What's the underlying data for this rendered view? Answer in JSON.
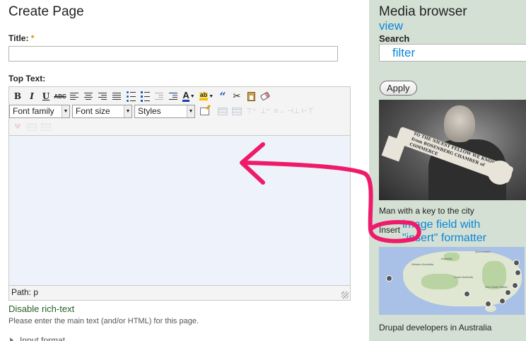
{
  "page": {
    "title": "Create Page",
    "title_field": {
      "label": "Title:",
      "required_mark": "*",
      "value": ""
    },
    "top_text": {
      "label": "Top Text:"
    },
    "editor": {
      "toolbar_row1": [
        "bold-button",
        "italic-button",
        "underline-button",
        "strikethrough-button",
        "align-left-button",
        "align-center-button",
        "align-right-button",
        "align-justify-button",
        "bullet-list-button",
        "numbered-list-button",
        "outdent-button",
        "indent-button",
        "font-color-button",
        "highlight-color-button",
        "blockquote-button",
        "cut-button",
        "paste-button",
        "remove-format-button"
      ],
      "bold": "B",
      "italic": "I",
      "underline": "U",
      "strike": "ABC",
      "font_family": "Font family",
      "font_size": "Font size",
      "styles": "Styles",
      "path": "Path: p"
    },
    "disable_link": "Disable rich-text",
    "help": "Please enter the main text (and/or HTML) for this page.",
    "input_format": "Input format"
  },
  "sidebar": {
    "title": "Media browser",
    "view_link": "view",
    "search_label": "Search",
    "search_value": "filter",
    "apply_label": "Apply",
    "photo_key_text": [
      "TO THE NICEST FELLOW WE KNOW",
      "from ROSENBERG CHAMBER of COMMERCE"
    ],
    "caption1": "Man with a key to the city",
    "insert_label": "Insert",
    "annotation": [
      "image field with",
      "\"insert\" formatter"
    ],
    "map_labels": [
      "Western Australia",
      "Australia",
      "South Australia",
      "Queensland",
      "New South Wales"
    ],
    "caption2": "Drupal developers in Australia"
  },
  "colors": {
    "sidebar_bg": "#d4e0d4",
    "link_blue": "#0a86d8",
    "annotation_pink": "#ee1b6b",
    "editor_bg": "#eef3fb",
    "required": "#e09000"
  }
}
